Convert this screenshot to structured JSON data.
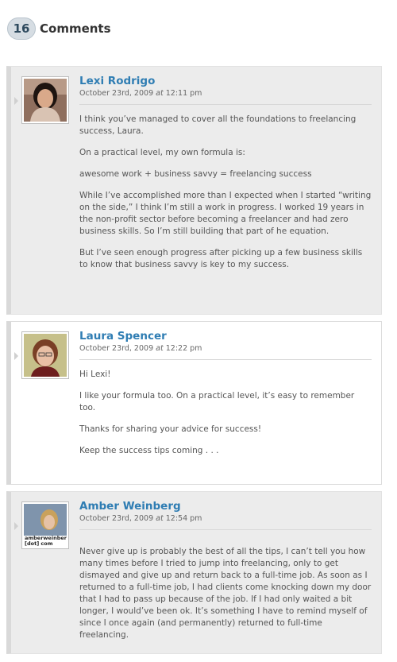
{
  "header": {
    "count": "16",
    "title": "Comments"
  },
  "comments": [
    {
      "author": "Lexi Rodrigo",
      "date": "October 23rd, 2009",
      "at": "at",
      "time": "12:11 pm",
      "paragraphs": [
        "I think you’ve managed to cover all the foundations to freelancing success, Laura.",
        "On a practical level, my own formula is:",
        "awesome work + business savvy = freelancing success",
        "While I’ve accomplished more than I expected when I started “writing on the side,” I think I’m still a work in progress. I worked 19 years in the non-profit sector before becoming a freelancer and had zero business skills. So I’m still building that part of he equation.",
        "But I’ve seen enough progress after picking up a few business skills to know that business savvy is key to my success."
      ]
    },
    {
      "author": "Laura Spencer",
      "date": "October 23rd, 2009",
      "at": "at",
      "time": "12:22 pm",
      "paragraphs": [
        "Hi Lexi!",
        "I like your formula too. On a practical level, it’s easy to remember too.",
        "Thanks for sharing your advice for success!",
        "Keep the success tips coming . . ."
      ]
    },
    {
      "author": "Amber Weinberg",
      "date": "October 23rd, 2009",
      "at": "at",
      "time": "12:54 pm",
      "avatar_caption": "amberweinberg [dot] com",
      "paragraphs": [
        "Never give up is probably the best of all the tips, I can’t tell you how many times before I tried to jump into freelancing, only to get dismayed and give up and return back to a full-time job. As soon as I returned to a full-time job, I had clients come knocking down my door that I had to pass up because of the job. If I had only waited a bit longer, I would’ve been ok. It’s something I have to remind myself of since I once again (and permanently) returned to full-time freelancing."
      ]
    }
  ]
}
